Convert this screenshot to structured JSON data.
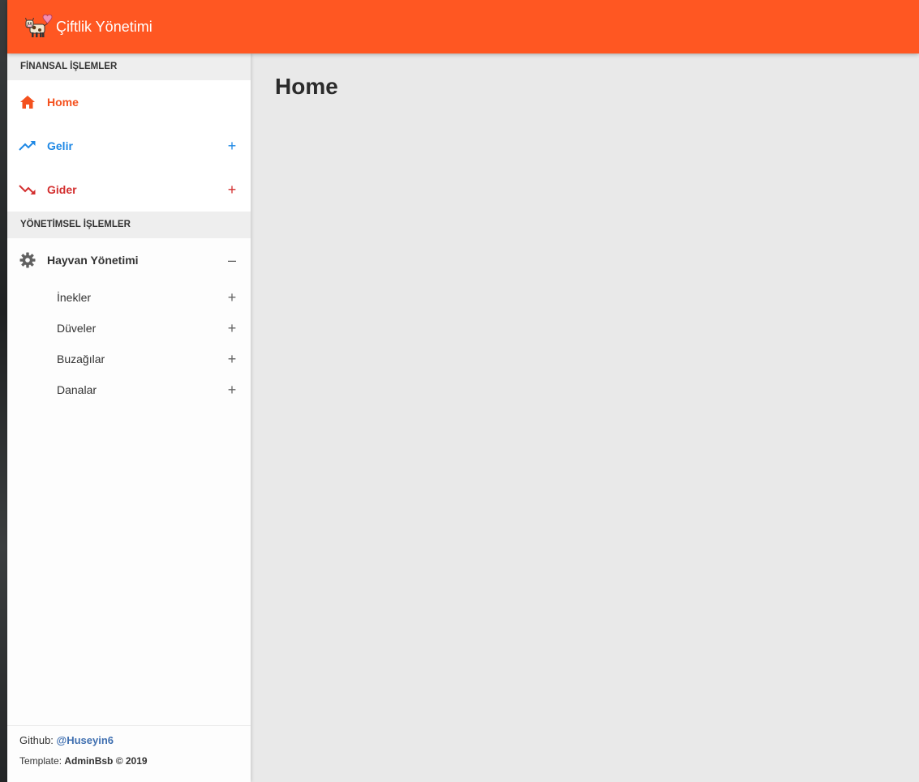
{
  "app": {
    "title": "Çiftlik Yönetimi"
  },
  "sidebar": {
    "sections": [
      {
        "header": "FİNANSAL İŞLEMLER",
        "items": [
          {
            "label": "Home",
            "icon": "home-icon",
            "toggle": "",
            "color": "#f4511e"
          },
          {
            "label": "Gelir",
            "icon": "trending-up-icon",
            "toggle": "+",
            "color": "#1e88e5"
          },
          {
            "label": "Gider",
            "icon": "trending-down-icon",
            "toggle": "+",
            "color": "#d32f2f"
          }
        ]
      },
      {
        "header": "YÖNETİMSEL İŞLEMLER",
        "items": [
          {
            "label": "Hayvan Yönetimi",
            "icon": "gear-icon",
            "toggle": "–",
            "color": "#333333"
          }
        ]
      }
    ],
    "submenu": [
      {
        "label": "İnekler",
        "toggle": "+"
      },
      {
        "label": "Düveler",
        "toggle": "+"
      },
      {
        "label": "Buzağılar",
        "toggle": "+"
      },
      {
        "label": "Danalar",
        "toggle": "+"
      }
    ],
    "footer": {
      "github_prefix": "Github: ",
      "github_user": "@Huseyin6",
      "template_prefix": "Template: ",
      "template_name": "AdminBsb © 2019"
    }
  },
  "main": {
    "page_title": "Home"
  },
  "colors": {
    "accent": "#ff5722",
    "content_bg": "#e9e9e9"
  }
}
